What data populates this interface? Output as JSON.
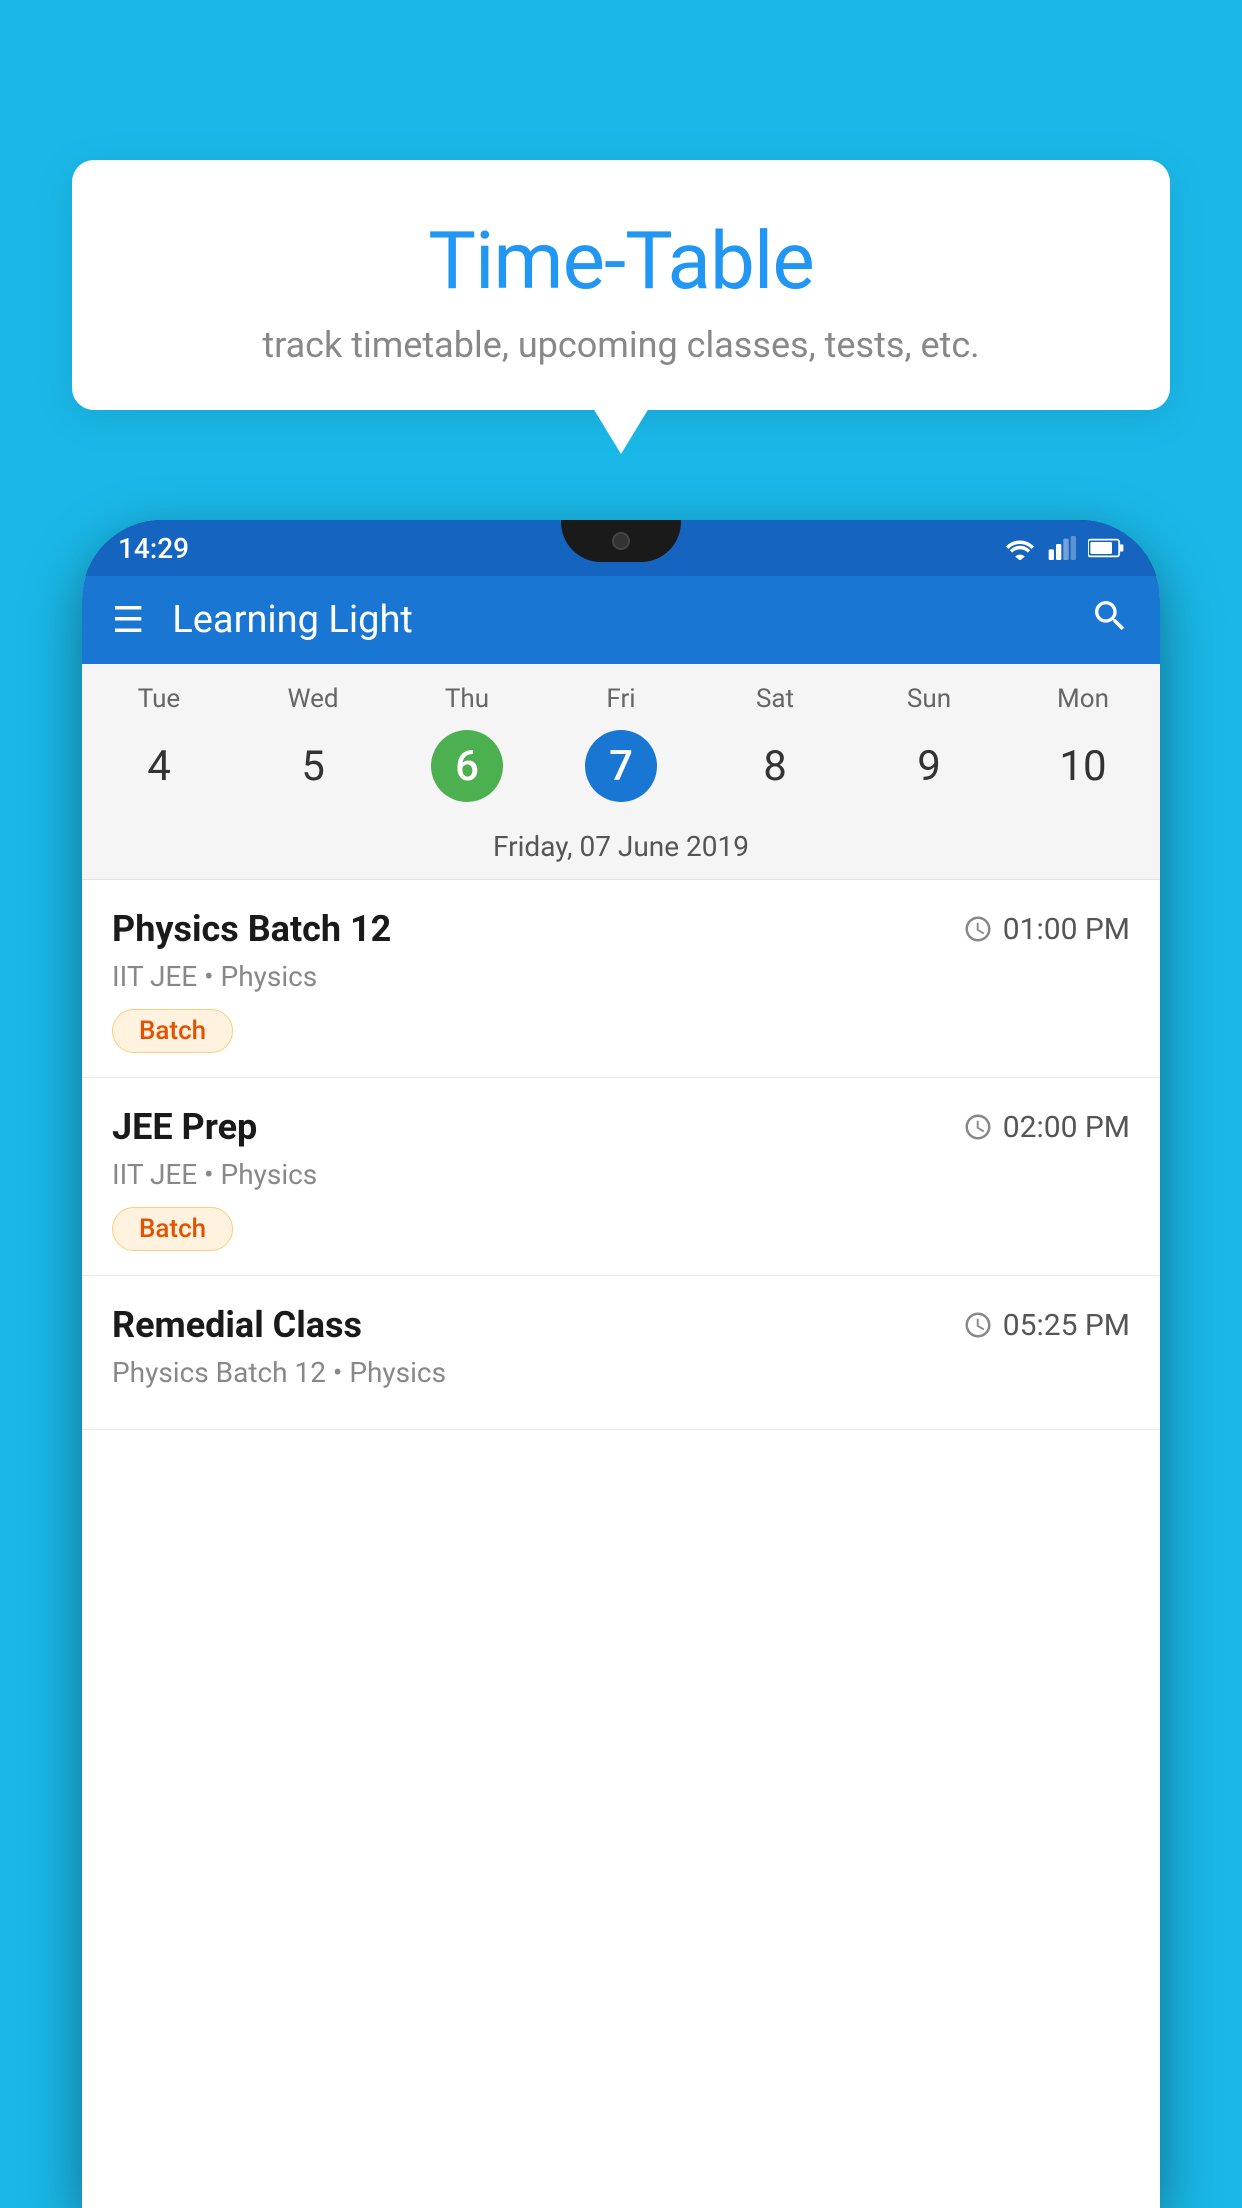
{
  "page": {
    "background_color": "#1ab8e8"
  },
  "tooltip": {
    "title": "Time-Table",
    "subtitle": "track timetable, upcoming classes, tests, etc."
  },
  "phone": {
    "status_bar": {
      "time": "14:29"
    },
    "app_bar": {
      "title": "Learning Light"
    },
    "calendar": {
      "weekdays": [
        "Tue",
        "Wed",
        "Thu",
        "Fri",
        "Sat",
        "Sun",
        "Mon"
      ],
      "dates": [
        4,
        5,
        6,
        7,
        8,
        9,
        10
      ],
      "today_index": 2,
      "selected_index": 3,
      "selected_date_label": "Friday, 07 June 2019"
    },
    "schedule": [
      {
        "title": "Physics Batch 12",
        "time": "01:00 PM",
        "subtitle": "IIT JEE • Physics",
        "badge": "Batch"
      },
      {
        "title": "JEE Prep",
        "time": "02:00 PM",
        "subtitle": "IIT JEE • Physics",
        "badge": "Batch"
      },
      {
        "title": "Remedial Class",
        "time": "05:25 PM",
        "subtitle": "Physics Batch 12 • Physics",
        "badge": null
      }
    ]
  }
}
